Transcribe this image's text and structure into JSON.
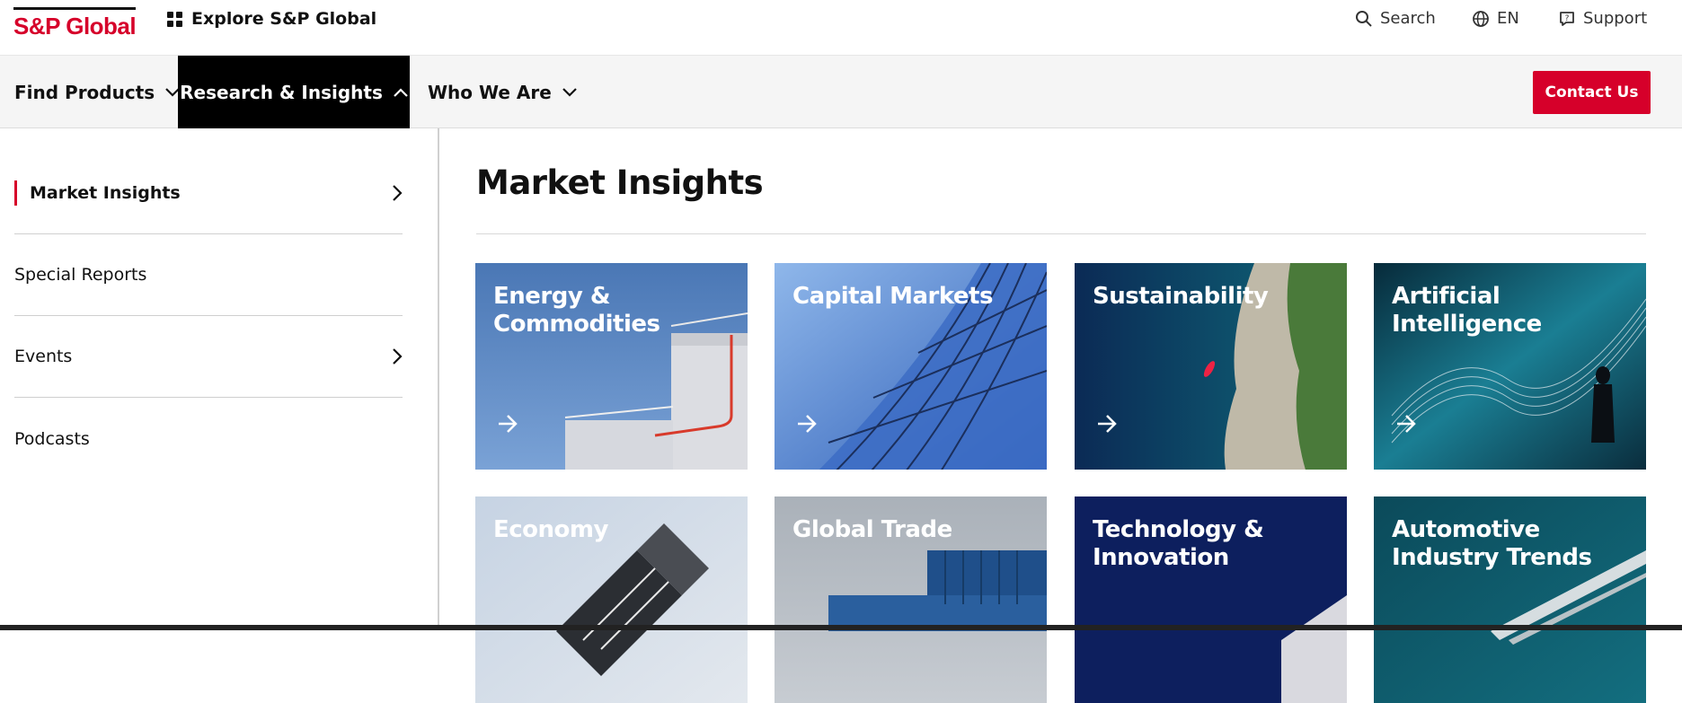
{
  "header": {
    "logo_text": "S&P Global",
    "explore_label": "Explore S&P Global",
    "utility": {
      "search_label": "Search",
      "language_label": "EN",
      "support_label": "Support"
    }
  },
  "nav": {
    "items": [
      {
        "label": "Find Products"
      },
      {
        "label": "Research & Insights"
      },
      {
        "label": "Who We Are"
      }
    ],
    "contact_label": "Contact Us"
  },
  "sidebar": {
    "items": [
      {
        "label": "Market Insights"
      },
      {
        "label": "Special Reports"
      },
      {
        "label": "Events"
      },
      {
        "label": "Podcasts"
      }
    ]
  },
  "main": {
    "title": "Market Insights",
    "cards": [
      {
        "title": "Energy & Commodities"
      },
      {
        "title": "Capital Markets"
      },
      {
        "title": "Sustainability"
      },
      {
        "title": "Artificial Intelligence"
      },
      {
        "title": "Economy"
      },
      {
        "title": "Global Trade"
      },
      {
        "title": "Technology & Innovation"
      },
      {
        "title": "Automotive Industry Trends"
      }
    ]
  },
  "colors": {
    "brand_red": "#d6002a",
    "nav_active_bg": "#000000",
    "nav_bg": "#f5f5f5"
  }
}
